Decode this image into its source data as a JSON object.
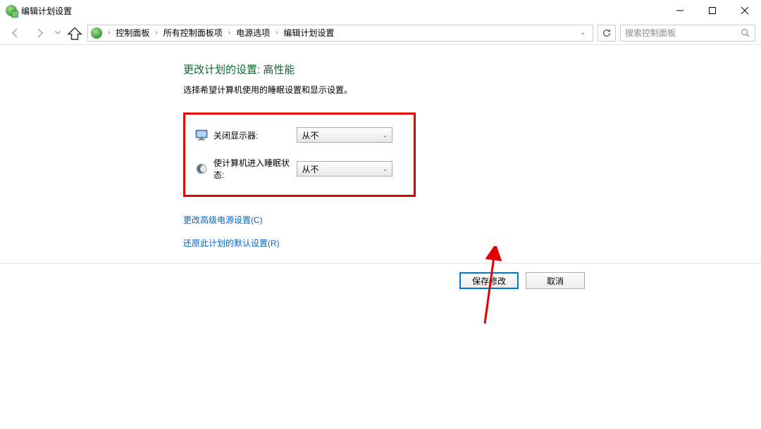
{
  "window": {
    "title": "编辑计划设置"
  },
  "breadcrumb": {
    "items": [
      "控制面板",
      "所有控制面板项",
      "电源选项",
      "编辑计划设置"
    ]
  },
  "search": {
    "placeholder": "搜索控制面板"
  },
  "page": {
    "title": "更改计划的设置: 高性能",
    "desc": "选择希望计算机使用的睡眠设置和显示设置。"
  },
  "settings": {
    "display_off": {
      "label": "关闭显示器:",
      "value": "从不"
    },
    "sleep": {
      "label": "使计算机进入睡眠状态:",
      "value": "从不"
    }
  },
  "links": {
    "advanced": "更改高级电源设置(C)",
    "restore": "还原此计划的默认设置(R)"
  },
  "buttons": {
    "save": "保存修改",
    "cancel": "取消"
  }
}
